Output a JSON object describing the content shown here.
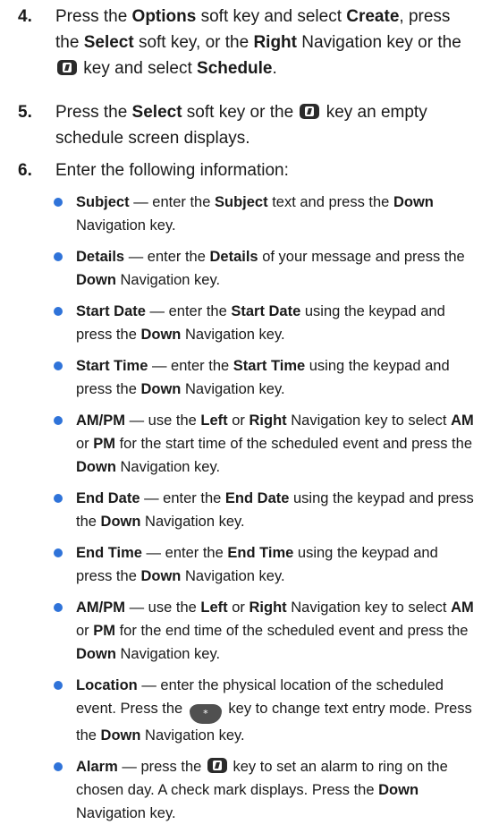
{
  "icons": {
    "info_key": "info-key-icon",
    "star_key": "star-key-icon"
  },
  "colors": {
    "bullet": "#2f73d9",
    "text": "#1a1a1a"
  },
  "steps": [
    {
      "number": "4.",
      "t1": "Press the ",
      "b1": "Options",
      "t2": " soft key and select ",
      "b2": "Create",
      "t3": ", press the ",
      "b3": "Select",
      "t4": " soft key, or the ",
      "b4": "Right",
      "t5": " Navigation key or the ",
      "t6": " key and select ",
      "b5": "Schedule",
      "t7": "."
    },
    {
      "number": "5.",
      "t1": "Press the ",
      "b1": "Select",
      "t2": " soft key or the ",
      "t3": " key an empty schedule screen displays."
    },
    {
      "number": "6.",
      "t1": "Enter the following information:"
    }
  ],
  "bullets": [
    {
      "label": "Subject",
      "t1": " — enter the ",
      "b1": "Subject",
      "t2": " text and press the ",
      "b2": "Down",
      "t3": " Navigation key."
    },
    {
      "label": "Details",
      "t1": " — enter the ",
      "b1": "Details",
      "t2": " of your message and press the ",
      "b2": "Down",
      "t3": " Navigation key."
    },
    {
      "label": "Start Date",
      "t1": " — enter the ",
      "b1": "Start Date",
      "t2": " using the keypad and press the ",
      "b2": "Down",
      "t3": " Navigation key."
    },
    {
      "label": "Start Time",
      "t1": " — enter the ",
      "b1": "Start Time",
      "t2": " using the keypad and press the ",
      "b2": "Down",
      "t3": " Navigation key."
    },
    {
      "label": "AM/PM",
      "t1": " — use the ",
      "b1": "Left",
      "t2": " or ",
      "b2": "Right",
      "t3": " Navigation key to select ",
      "b3": "AM",
      "t4": " or ",
      "b4": "PM",
      "t5": " for the start time of the scheduled event and press the ",
      "b5": "Down",
      "t6": " Navigation key."
    },
    {
      "label": "End Date",
      "t1": " — enter the ",
      "b1": "End Date",
      "t2": " using the keypad and press the ",
      "b2": "Down",
      "t3": " Navigation key."
    },
    {
      "label": "End Time",
      "t1": " — enter the ",
      "b1": "End Time",
      "t2": " using the keypad and press the ",
      "b2": "Down",
      "t3": " Navigation key."
    },
    {
      "label": "AM/PM",
      "t1": " — use the ",
      "b1": "Left",
      "t2": " or ",
      "b2": "Right",
      "t3": " Navigation key to select ",
      "b3": "AM",
      "t4": " or ",
      "b4": "PM",
      "t5": " for the end time of the scheduled event and press the ",
      "b5": "Down",
      "t6": " Navigation key."
    },
    {
      "label": "Location",
      "t1": " — enter the physical location of the scheduled event.   Press the ",
      "star": "*",
      "t2": " key to change text entry mode. Press the ",
      "b1": "Down",
      "t3": " Navigation key."
    },
    {
      "label": "Alarm",
      "t1": " — press the ",
      "t2": " key to set an alarm to ring on the chosen day. A check mark displays. Press the ",
      "b1": "Down",
      "t3": " Navigation key."
    }
  ]
}
